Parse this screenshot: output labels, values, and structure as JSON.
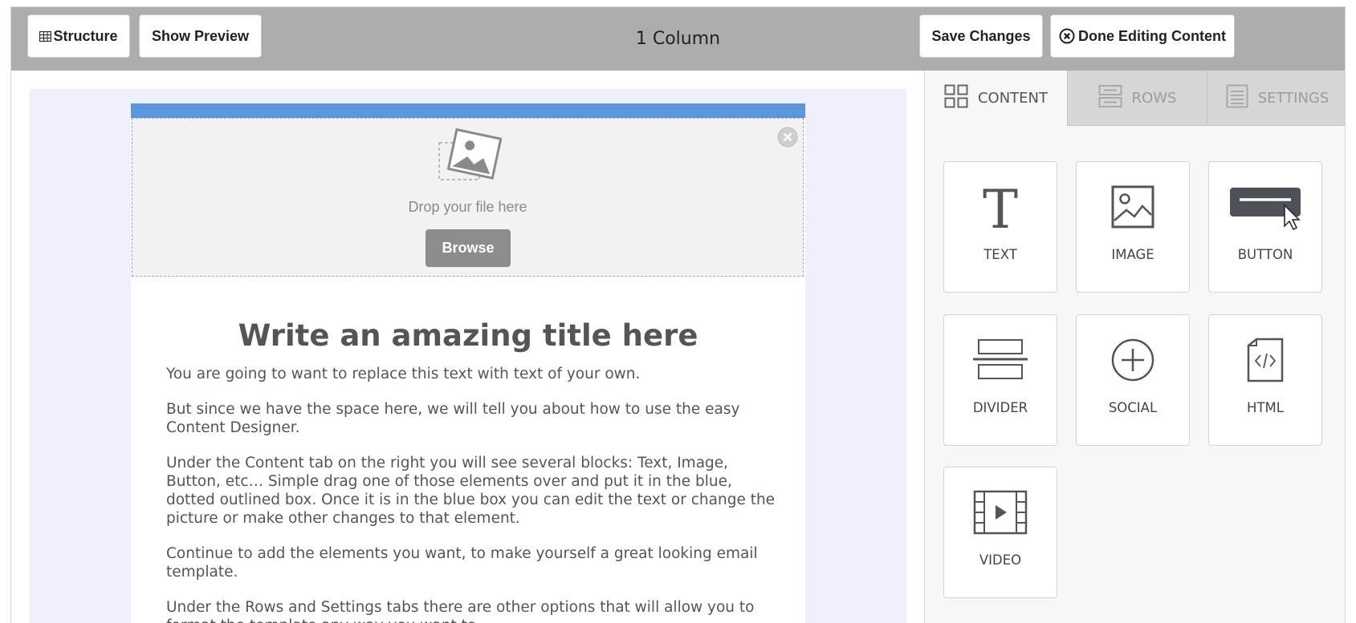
{
  "toolbar": {
    "structure_label": "Structure",
    "preview_label": "Show Preview",
    "title": "1 Column",
    "save_label": "Save Changes",
    "done_label": "Done Editing Content"
  },
  "email": {
    "drop_text": "Drop your file here",
    "browse_label": "Browse",
    "title": "Write an amazing title here",
    "paragraphs": [
      "You are going to want to replace this text with text of your own.",
      "But since we have the space here, we will tell you about how to use the easy Content Designer.",
      "Under the Content tab on the right you will see several blocks: Text, Image, Button, etc… Simple drag one of those elements over and put it in the blue, dotted outlined box. Once it is in the blue box you can edit the text or change the picture or make other changes to that element.",
      "Continue to add the elements you want, to make yourself a great looking email template.",
      "Under the Rows and Settings tabs there are other options that will allow you to format the template any way you want to."
    ]
  },
  "sidebar": {
    "tabs": [
      {
        "label": "CONTENT",
        "icon": "grid-icon",
        "active": true
      },
      {
        "label": "ROWS",
        "icon": "rows-icon",
        "active": false
      },
      {
        "label": "SETTINGS",
        "icon": "settings-list-icon",
        "active": false
      }
    ],
    "blocks": [
      {
        "label": "TEXT",
        "icon": "text-icon"
      },
      {
        "label": "IMAGE",
        "icon": "image-icon"
      },
      {
        "label": "BUTTON",
        "icon": "button-icon"
      },
      {
        "label": "DIVIDER",
        "icon": "divider-icon"
      },
      {
        "label": "SOCIAL",
        "icon": "social-icon"
      },
      {
        "label": "HTML",
        "icon": "html-file-icon"
      },
      {
        "label": "VIDEO",
        "icon": "video-icon"
      }
    ]
  },
  "colors": {
    "topbar": "#adadad",
    "accent_bar": "#5a96dc",
    "canvas_bg": "#eef0fc",
    "browse_button": "#8c8c8c"
  }
}
